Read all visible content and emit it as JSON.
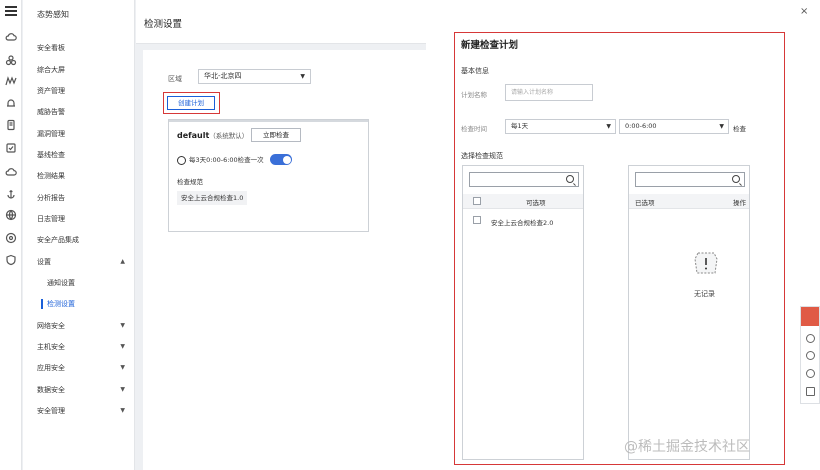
{
  "sidebar": {
    "brand": "态势感知",
    "items": [
      {
        "label": "安全看板"
      },
      {
        "label": "综合大屏"
      },
      {
        "label": "资产管理"
      },
      {
        "label": "威胁告警"
      },
      {
        "label": "漏洞管理"
      },
      {
        "label": "基线检查"
      },
      {
        "label": "检测结果"
      },
      {
        "label": "分析报告"
      },
      {
        "label": "日志管理"
      },
      {
        "label": "安全产品集成"
      },
      {
        "label": "设置",
        "caret": "▲"
      },
      {
        "label": "网络安全",
        "caret": "▼"
      },
      {
        "label": "主机安全",
        "caret": "▼"
      },
      {
        "label": "应用安全",
        "caret": "▼"
      },
      {
        "label": "数据安全",
        "caret": "▼"
      },
      {
        "label": "安全管理",
        "caret": "▼"
      }
    ],
    "sub_items": [
      {
        "label": "通知设置"
      },
      {
        "label": "检测设置"
      }
    ]
  },
  "icon_rail": [
    "menu-icon",
    "cloud-icon",
    "cluster-icon",
    "chart-icon",
    "alarm-icon",
    "document-icon",
    "task-icon",
    "cloud-check-icon",
    "anchor-icon",
    "globe-icon",
    "setting-icon",
    "shield-icon"
  ],
  "main": {
    "title": "检测设置",
    "region_label": "区域",
    "region_value": "华北-北京四",
    "create_plan": "创建计划",
    "plan": {
      "name": "default",
      "sub": "（系统默认）",
      "check_now": "立即检查",
      "schedule": "每3天0:00-6:00检查一次",
      "enabled": true,
      "spec_label": "检查规范",
      "spec_value": "安全上云合规检查1.0"
    }
  },
  "dialog": {
    "title": "新建检查计划",
    "basic_info": "基本信息",
    "plan_name_label": "计划名称",
    "plan_name_placeholder": "请输入计划名称",
    "check_time_label": "检查时间",
    "frequency": "每1天",
    "time_range": "0:00-6:00",
    "after_text": "检查",
    "spec_title": "选择检查规范",
    "left_pane": {
      "header": "可选项",
      "options": [
        "安全上云合规检查2.0"
      ]
    },
    "right_pane": {
      "header_selected": "已选项",
      "header_action": "操作",
      "empty_text": "无记录"
    },
    "close": "×"
  },
  "watermark": "@稀土掘金技术社区",
  "colors": {
    "primary": "#1a5fd8",
    "highlight_border": "#d63838",
    "toggle_on": "#3a6fd8",
    "float_accent": "#e05a45"
  }
}
